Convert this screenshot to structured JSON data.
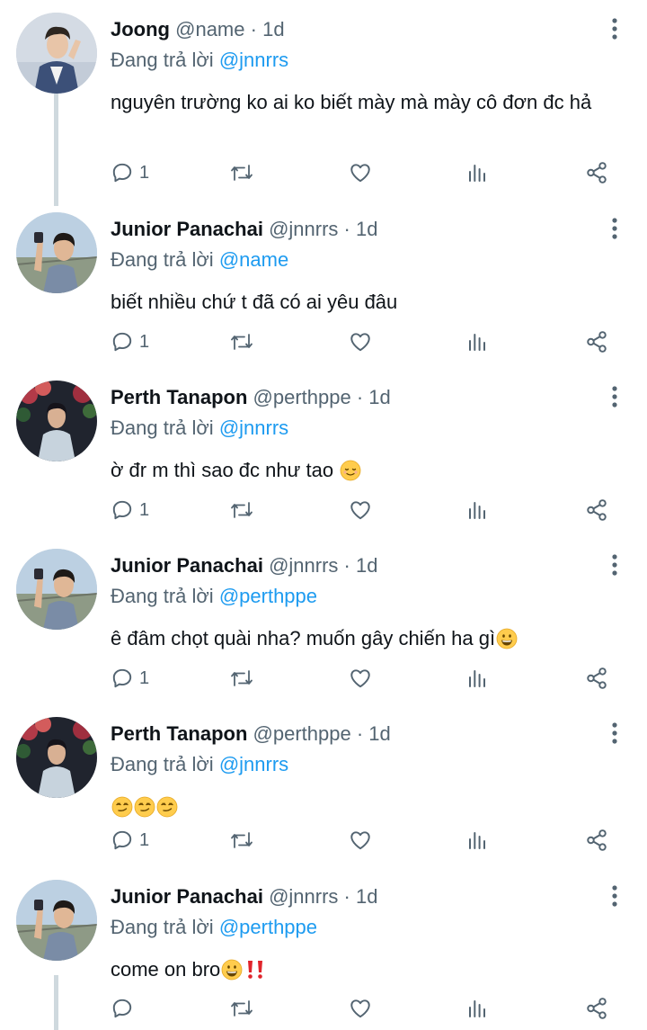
{
  "reply_prefix": "Đang trả lời",
  "tweets": [
    {
      "name": "Joong",
      "handle": "@name",
      "sep": "·",
      "time": "1d",
      "reply_to": "@jnnrrs",
      "text": "nguyên trường ko ai ko biết mày mà mày cô đơn đc hả",
      "reply_count": "1",
      "avatar": "avatar-joong"
    },
    {
      "name": "Junior Panachai",
      "handle": "@jnnrrs",
      "sep": "·",
      "time": "1d",
      "reply_to": "@name",
      "text": "biết nhiều chứ t đã có ai yêu đâu",
      "reply_count": "1",
      "avatar": "avatar-junior"
    },
    {
      "name": "Perth Tanapon",
      "handle": "@perthppe",
      "sep": "·",
      "time": "1d",
      "reply_to": "@jnnrrs",
      "text": "ờ đr m thì sao đc như tao",
      "emoji": [
        "relieved-face-emoji"
      ],
      "reply_count": "1",
      "avatar": "avatar-perth"
    },
    {
      "name": "Junior Panachai",
      "handle": "@jnnrrs",
      "sep": "·",
      "time": "1d",
      "reply_to": "@perthppe",
      "text": "ê đâm chọt quài nha? muốn gây chiến ha gì",
      "emoji": [
        "grinning-face-emoji"
      ],
      "reply_count": "1",
      "avatar": "avatar-junior"
    },
    {
      "name": "Perth Tanapon",
      "handle": "@perthppe",
      "sep": "·",
      "time": "1d",
      "reply_to": "@jnnrrs",
      "text": "",
      "emoji": [
        "smirking-face-emoji",
        "smirking-face-emoji",
        "smirking-face-emoji"
      ],
      "reply_count": "1",
      "avatar": "avatar-perth"
    },
    {
      "name": "Junior Panachai",
      "handle": "@jnnrrs",
      "sep": "·",
      "time": "1d",
      "reply_to": "@perthppe",
      "text": "come on bro",
      "emoji": [
        "grinning-face-emoji",
        "double-exclamation-emoji"
      ],
      "reply_count": "",
      "avatar": "avatar-junior"
    }
  ],
  "icons": {
    "reply": "reply-icon",
    "retweet": "retweet-icon",
    "like": "heart-icon",
    "views": "views-icon",
    "share": "share-icon",
    "more": "more-vertical-icon"
  },
  "colors": {
    "mention": "#1d9bf0",
    "secondary_text": "#536471",
    "thread_line": "#cfd9de"
  }
}
